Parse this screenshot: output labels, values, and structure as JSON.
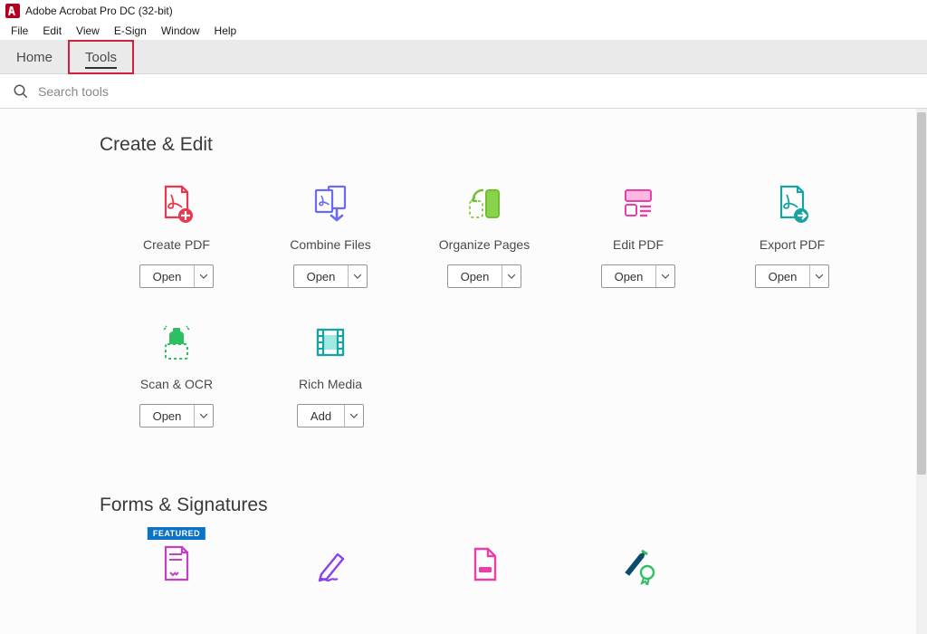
{
  "window": {
    "title": "Adobe Acrobat Pro DC (32-bit)"
  },
  "menus": [
    "File",
    "Edit",
    "View",
    "E-Sign",
    "Window",
    "Help"
  ],
  "tabs": {
    "home": "Home",
    "tools": "Tools"
  },
  "search": {
    "placeholder": "Search tools"
  },
  "sections": {
    "create_edit": {
      "title": "Create & Edit",
      "tools": [
        {
          "label": "Create PDF",
          "action": "Open",
          "icon": "create-pdf-icon"
        },
        {
          "label": "Combine Files",
          "action": "Open",
          "icon": "combine-files-icon"
        },
        {
          "label": "Organize Pages",
          "action": "Open",
          "icon": "organize-pages-icon"
        },
        {
          "label": "Edit PDF",
          "action": "Open",
          "icon": "edit-pdf-icon"
        },
        {
          "label": "Export PDF",
          "action": "Open",
          "icon": "export-pdf-icon"
        },
        {
          "label": "Scan & OCR",
          "action": "Open",
          "icon": "scan-ocr-icon"
        },
        {
          "label": "Rich Media",
          "action": "Add",
          "icon": "rich-media-icon"
        }
      ]
    },
    "forms_signatures": {
      "title": "Forms & Signatures",
      "badge": "FEATURED",
      "tools_partial": [
        {
          "icon": "request-signatures-icon"
        },
        {
          "icon": "fill-sign-icon"
        },
        {
          "icon": "prepare-form-icon"
        },
        {
          "icon": "certificates-icon"
        }
      ]
    }
  }
}
